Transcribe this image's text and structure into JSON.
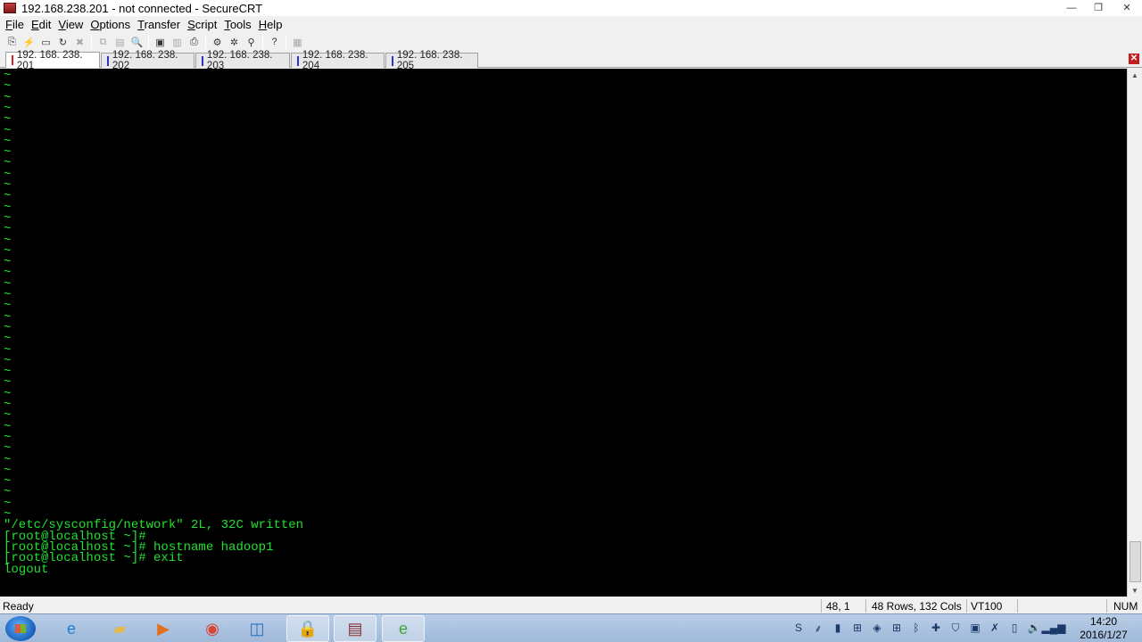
{
  "window": {
    "title": "192.168.238.201 - not connected - SecureCRT",
    "minimize_glyph": "—",
    "restore_glyph": "❐",
    "close_glyph": "✕"
  },
  "menu": [
    {
      "label": "File",
      "ul": "F",
      "rest": "ile"
    },
    {
      "label": "Edit",
      "ul": "E",
      "rest": "dit"
    },
    {
      "label": "View",
      "ul": "V",
      "rest": "iew"
    },
    {
      "label": "Options",
      "ul": "O",
      "rest": "ptions"
    },
    {
      "label": "Transfer",
      "ul": "T",
      "rest": "ransfer"
    },
    {
      "label": "Script",
      "ul": "S",
      "rest": "cript"
    },
    {
      "label": "Tools",
      "ul": "T",
      "rest": "ools"
    },
    {
      "label": "Help",
      "ul": "H",
      "rest": "elp"
    }
  ],
  "toolbar": [
    {
      "name": "connect-icon",
      "glyph": "⎘",
      "enabled": true
    },
    {
      "name": "quick-connect-icon",
      "glyph": "⚡",
      "enabled": true
    },
    {
      "name": "connect-in-tab-icon",
      "glyph": "▭",
      "enabled": true
    },
    {
      "name": "reconnect-icon",
      "glyph": "↻",
      "enabled": true
    },
    {
      "name": "disconnect-icon",
      "glyph": "✖",
      "enabled": false
    },
    {
      "sep": true
    },
    {
      "name": "copy-icon",
      "glyph": "⧉",
      "enabled": false
    },
    {
      "name": "paste-icon",
      "glyph": "▤",
      "enabled": false
    },
    {
      "name": "find-icon",
      "glyph": "🔍",
      "enabled": true
    },
    {
      "sep": true
    },
    {
      "name": "print-setup-icon",
      "glyph": "▣",
      "enabled": true
    },
    {
      "name": "print-screen-icon",
      "glyph": "▥",
      "enabled": false
    },
    {
      "name": "print-icon",
      "glyph": "⎙",
      "enabled": true
    },
    {
      "sep": true
    },
    {
      "name": "session-options-icon",
      "glyph": "⚙",
      "enabled": true
    },
    {
      "name": "global-options-icon",
      "glyph": "✲",
      "enabled": true
    },
    {
      "name": "keymap-icon",
      "glyph": "⚲",
      "enabled": true
    },
    {
      "sep": true
    },
    {
      "name": "help-icon",
      "glyph": "?",
      "enabled": true
    },
    {
      "sep": true
    },
    {
      "name": "sftp-icon",
      "glyph": "▦",
      "enabled": false
    }
  ],
  "tabs": [
    {
      "label": "192. 168. 238. 201",
      "active": true
    },
    {
      "label": "192. 168. 238. 202",
      "active": false
    },
    {
      "label": "192. 168. 238. 203",
      "active": false
    },
    {
      "label": "192. 168. 238. 204",
      "active": false
    },
    {
      "label": "192. 168. 238. 205",
      "active": false
    }
  ],
  "tab_close_glyph": "✕",
  "terminal": {
    "tilde_line": "~",
    "tilde_count": 41,
    "lines": [
      "\"/etc/sysconfig/network\" 2L, 32C written",
      "[root@localhost ~]#",
      "[root@localhost ~]# hostname hadoop1",
      "[root@localhost ~]# exit",
      "logout"
    ]
  },
  "scroll": {
    "up": "▲",
    "down": "▼"
  },
  "status": {
    "ready": "Ready",
    "position": "48,  1",
    "size": "48 Rows, 132 Cols",
    "emulation": "VT100",
    "num": "NUM"
  },
  "taskbar": {
    "apps": [
      {
        "name": "internet-explorer-icon",
        "glyph": "e",
        "open": false,
        "color": "#1e7fd6"
      },
      {
        "name": "file-explorer-icon",
        "glyph": "▰",
        "open": false,
        "color": "#e2b84a"
      },
      {
        "name": "media-player-icon",
        "glyph": "▶",
        "open": false,
        "color": "#e07020"
      },
      {
        "name": "chrome-icon",
        "glyph": "◉",
        "open": false,
        "color": "#d94535"
      },
      {
        "name": "outlook-icon",
        "glyph": "◫",
        "open": false,
        "color": "#2a6fc0"
      },
      {
        "name": "securecrt-icon",
        "glyph": "🔒",
        "open": true,
        "color": "#444444"
      },
      {
        "name": "securefx-icon",
        "glyph": "▤",
        "open": true,
        "color": "#8a3030"
      },
      {
        "name": "browser-360-icon",
        "glyph": "e",
        "open": true,
        "color": "#3aa53a"
      }
    ],
    "tray": [
      {
        "name": "sogou-input-icon",
        "glyph": "S"
      },
      {
        "name": "tray-menu-icon",
        "glyph": "⸙"
      },
      {
        "name": "tray-app-icon",
        "glyph": "▮"
      },
      {
        "name": "network-drive-icon",
        "glyph": "⊞"
      },
      {
        "name": "security-shield-icon",
        "glyph": "◈"
      },
      {
        "name": "windows-icon",
        "glyph": "⊞"
      },
      {
        "name": "bluetooth-icon",
        "glyph": "ᛒ"
      },
      {
        "name": "update-icon",
        "glyph": "✚"
      },
      {
        "name": "antivirus-icon",
        "glyph": "⛉"
      },
      {
        "name": "display-icon",
        "glyph": "▣"
      },
      {
        "name": "no-network-icon",
        "glyph": "✗"
      },
      {
        "name": "device-icon",
        "glyph": "▯"
      },
      {
        "name": "volume-icon",
        "glyph": "🔈"
      },
      {
        "name": "signal-icon",
        "glyph": "▂▄▆"
      }
    ],
    "time": "14:20",
    "date": "2016/1/27"
  }
}
